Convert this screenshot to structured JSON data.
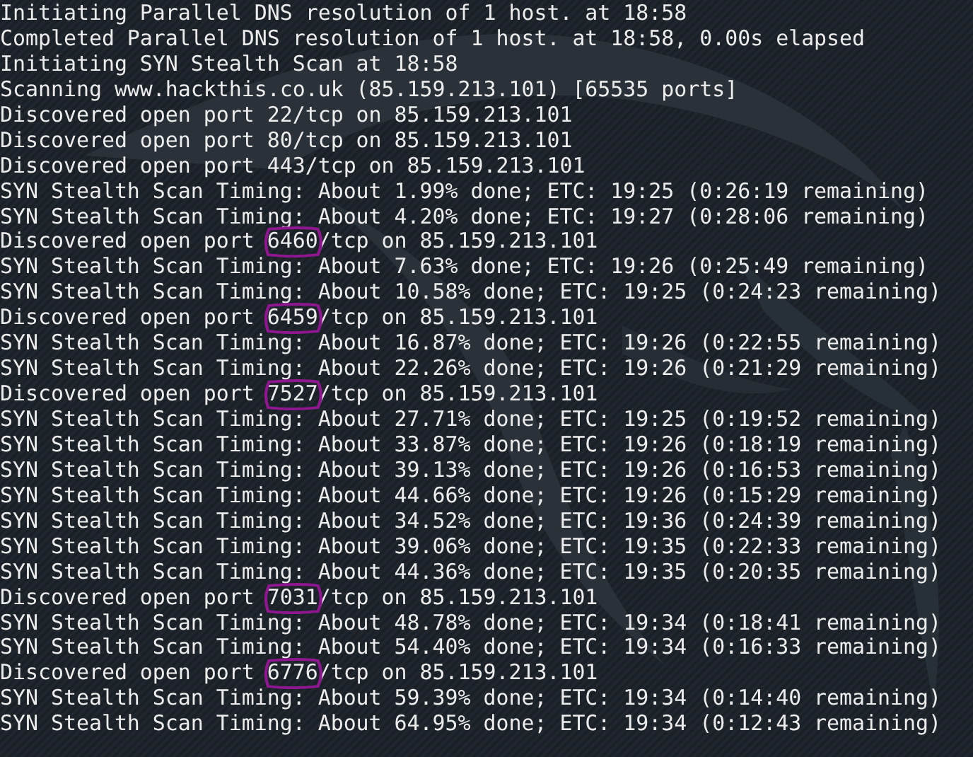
{
  "terminal": {
    "lines": [
      {
        "kind": "plain",
        "text": "Initiating Parallel DNS resolution of 1 host. at 18:58"
      },
      {
        "kind": "plain",
        "text": "Completed Parallel DNS resolution of 1 host. at 18:58, 0.00s elapsed"
      },
      {
        "kind": "plain",
        "text": "Initiating SYN Stealth Scan at 18:58"
      },
      {
        "kind": "plain",
        "text": "Scanning www.hackthis.co.uk (85.159.213.101) [65535 ports]"
      },
      {
        "kind": "port",
        "before": "Discovered open port ",
        "port": "22",
        "after": "/tcp on 85.159.213.101",
        "circled": false
      },
      {
        "kind": "port",
        "before": "Discovered open port ",
        "port": "80",
        "after": "/tcp on 85.159.213.101",
        "circled": false
      },
      {
        "kind": "port",
        "before": "Discovered open port ",
        "port": "443",
        "after": "/tcp on 85.159.213.101",
        "circled": false
      },
      {
        "kind": "plain",
        "text": "SYN Stealth Scan Timing: About 1.99% done; ETC: 19:25 (0:26:19 remaining)"
      },
      {
        "kind": "plain",
        "text": "SYN Stealth Scan Timing: About 4.20% done; ETC: 19:27 (0:28:06 remaining)"
      },
      {
        "kind": "port",
        "before": "Discovered open port ",
        "port": "6460",
        "after": "/tcp on 85.159.213.101",
        "circled": true
      },
      {
        "kind": "plain",
        "text": "SYN Stealth Scan Timing: About 7.63% done; ETC: 19:26 (0:25:49 remaining)"
      },
      {
        "kind": "plain",
        "text": "SYN Stealth Scan Timing: About 10.58% done; ETC: 19:25 (0:24:23 remaining)"
      },
      {
        "kind": "port",
        "before": "Discovered open port ",
        "port": "6459",
        "after": "/tcp on 85.159.213.101",
        "circled": true
      },
      {
        "kind": "plain",
        "text": "SYN Stealth Scan Timing: About 16.87% done; ETC: 19:26 (0:22:55 remaining)"
      },
      {
        "kind": "plain",
        "text": "SYN Stealth Scan Timing: About 22.26% done; ETC: 19:26 (0:21:29 remaining)"
      },
      {
        "kind": "port",
        "before": "Discovered open port ",
        "port": "7527",
        "after": "/tcp on 85.159.213.101",
        "circled": true
      },
      {
        "kind": "plain",
        "text": "SYN Stealth Scan Timing: About 27.71% done; ETC: 19:25 (0:19:52 remaining)"
      },
      {
        "kind": "plain",
        "text": "SYN Stealth Scan Timing: About 33.87% done; ETC: 19:26 (0:18:19 remaining)"
      },
      {
        "kind": "plain",
        "text": "SYN Stealth Scan Timing: About 39.13% done; ETC: 19:26 (0:16:53 remaining)"
      },
      {
        "kind": "plain",
        "text": "SYN Stealth Scan Timing: About 44.66% done; ETC: 19:26 (0:15:29 remaining)"
      },
      {
        "kind": "plain",
        "text": "SYN Stealth Scan Timing: About 34.52% done; ETC: 19:36 (0:24:39 remaining)"
      },
      {
        "kind": "plain",
        "text": "SYN Stealth Scan Timing: About 39.06% done; ETC: 19:35 (0:22:33 remaining)"
      },
      {
        "kind": "plain",
        "text": "SYN Stealth Scan Timing: About 44.36% done; ETC: 19:35 (0:20:35 remaining)"
      },
      {
        "kind": "port",
        "before": "Discovered open port ",
        "port": "7031",
        "after": "/tcp on 85.159.213.101",
        "circled": true
      },
      {
        "kind": "plain",
        "text": "SYN Stealth Scan Timing: About 48.78% done; ETC: 19:34 (0:18:41 remaining)"
      },
      {
        "kind": "plain",
        "text": "SYN Stealth Scan Timing: About 54.40% done; ETC: 19:34 (0:16:33 remaining)"
      },
      {
        "kind": "port",
        "before": "Discovered open port ",
        "port": "6776",
        "after": "/tcp on 85.159.213.101",
        "circled": true
      },
      {
        "kind": "plain",
        "text": "SYN Stealth Scan Timing: About 59.39% done; ETC: 19:34 (0:14:40 remaining)"
      },
      {
        "kind": "plain",
        "text": "SYN Stealth Scan Timing: About 64.95% done; ETC: 19:34 (0:12:43 remaining)"
      }
    ]
  }
}
